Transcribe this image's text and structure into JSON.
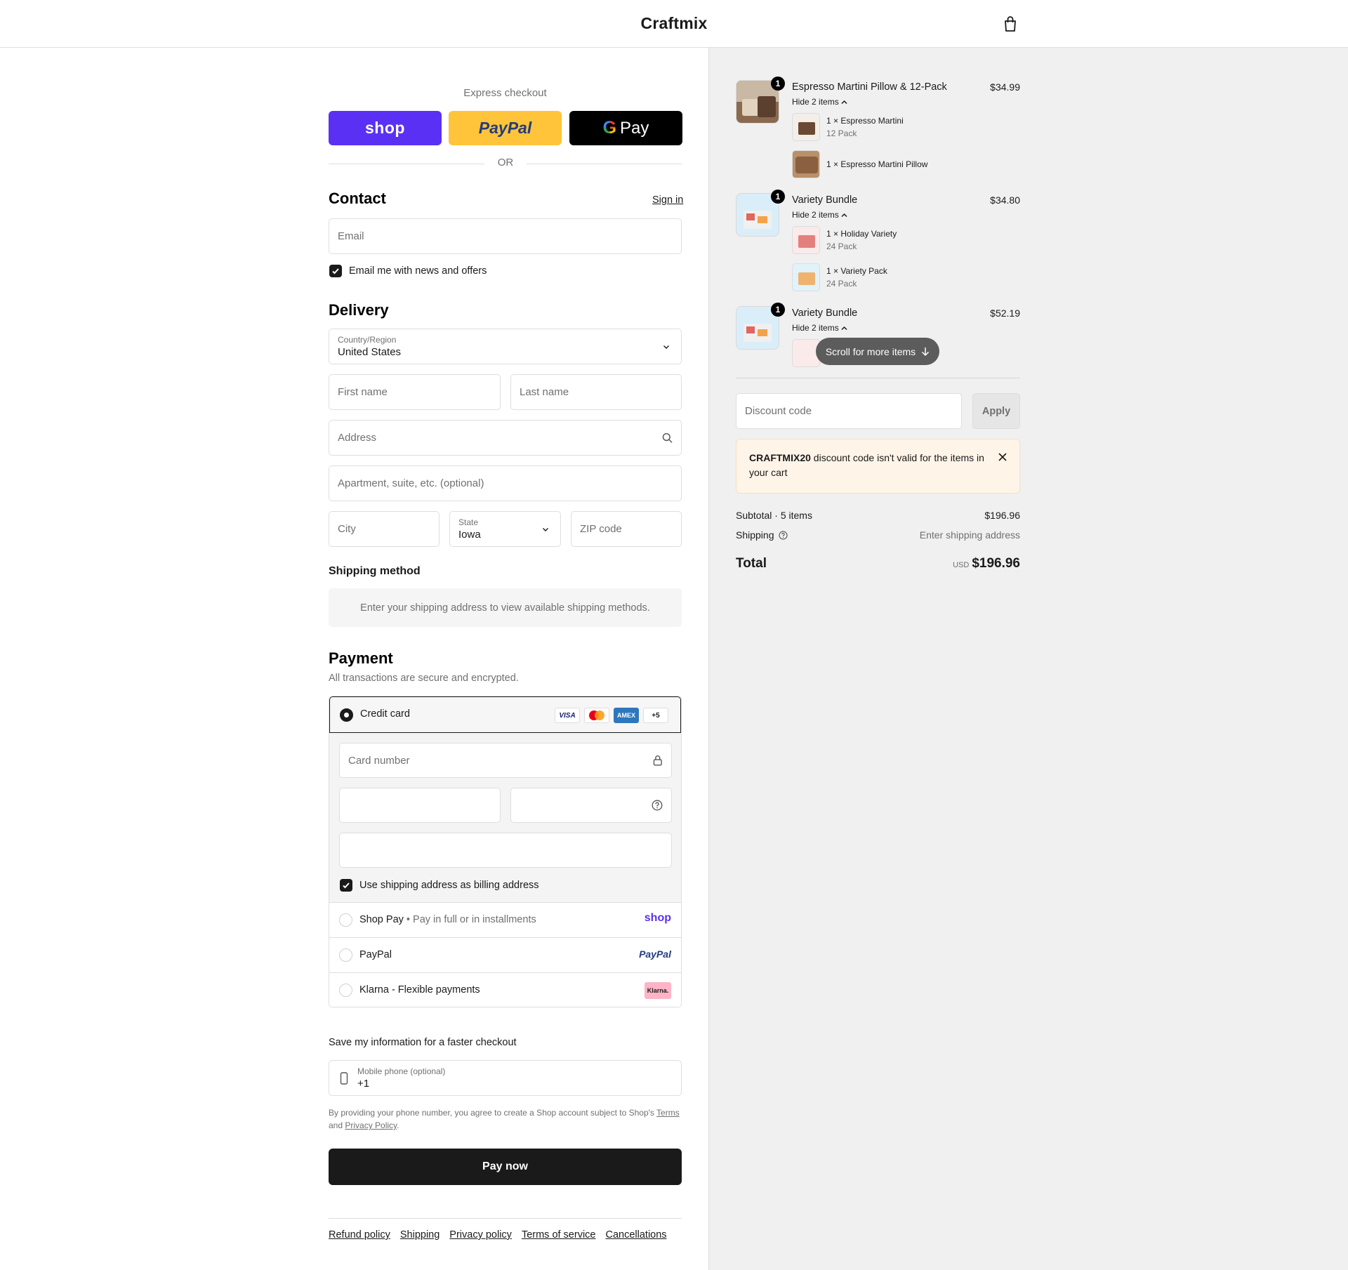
{
  "header": {
    "brand": "Craftmix",
    "cart_icon": "shopping-bag-icon"
  },
  "express": {
    "label": "Express checkout",
    "shop_label": "shop",
    "paypal_label": "PayPal",
    "gpay_label": "Pay",
    "or": "OR",
    "colors": {
      "shop": "#5a31f4",
      "paypal": "#ffc439",
      "gpay": "#000000"
    }
  },
  "contact": {
    "title": "Contact",
    "sign_in": "Sign in",
    "email_placeholder": "Email",
    "news_label": "Email me with news and offers",
    "news_checked": true
  },
  "delivery": {
    "title": "Delivery",
    "country_label": "Country/Region",
    "country_value": "United States",
    "first_name": "First name",
    "last_name": "Last name",
    "address": "Address",
    "apartment": "Apartment, suite, etc. (optional)",
    "city": "City",
    "state_label": "State",
    "state_value": "Iowa",
    "zip": "ZIP code"
  },
  "shipping_method": {
    "title": "Shipping method",
    "note": "Enter your shipping address to view available shipping methods."
  },
  "payment": {
    "title": "Payment",
    "subtitle": "All transactions are secure and encrypted.",
    "credit_card": "Credit card",
    "card_logos": [
      "VISA",
      "mastercard",
      "AMEX",
      "+5"
    ],
    "card_number_placeholder": "Card number",
    "billing_label": "Use shipping address as billing address",
    "shop_pay": "Shop Pay",
    "shop_pay_sub": "Pay in full or in installments",
    "shop_pay_logo": "shop",
    "paypal": "PayPal",
    "paypal_logo": "PayPal",
    "klarna": "Klarna - Flexible payments",
    "klarna_logo": "Klarna."
  },
  "save_info": {
    "title": "Save my information for a faster checkout",
    "phone_label": "Mobile phone (optional)",
    "phone_value": "+1",
    "legal_prefix": "By providing your phone number, you agree to create a Shop account subject to Shop's",
    "terms": "Terms",
    "and": "and",
    "privacy": "Privacy Policy",
    "period": "."
  },
  "pay_now": "Pay now",
  "footer_links": [
    "Refund policy",
    "Shipping",
    "Privacy policy",
    "Terms of service",
    "Cancellations"
  ],
  "cart": {
    "items": [
      {
        "qty": "1",
        "name": "Espresso Martini Pillow & 12-Pack",
        "price": "$34.99",
        "toggle": "Hide 2 items",
        "subitems": [
          {
            "qty": "1",
            "x": "×",
            "name": "Espresso Martini",
            "variant": "12 Pack"
          },
          {
            "qty": "1",
            "x": "×",
            "name": "Espresso Martini Pillow",
            "variant": ""
          }
        ]
      },
      {
        "qty": "1",
        "name": "Variety Bundle",
        "price": "$34.80",
        "toggle": "Hide 2 items",
        "subitems": [
          {
            "qty": "1",
            "x": "×",
            "name": "Holiday Variety",
            "variant": "24 Pack"
          },
          {
            "qty": "1",
            "x": "×",
            "name": "Variety Pack",
            "variant": "24 Pack"
          }
        ]
      },
      {
        "qty": "1",
        "name": "Variety Bundle",
        "price": "$52.19",
        "toggle": "Hide 2 items"
      }
    ],
    "scroll_hint": "Scroll for more items",
    "discount_placeholder": "Discount code",
    "apply": "Apply",
    "alert_code": "CRAFTMIX20",
    "alert_text": "discount code isn't valid for the items in your cart",
    "subtotal_label": "Subtotal · 5 items",
    "subtotal_value": "$196.96",
    "shipping_label": "Shipping",
    "shipping_value": "Enter shipping address",
    "total_label": "Total",
    "currency": "USD",
    "total_value": "$196.96"
  }
}
